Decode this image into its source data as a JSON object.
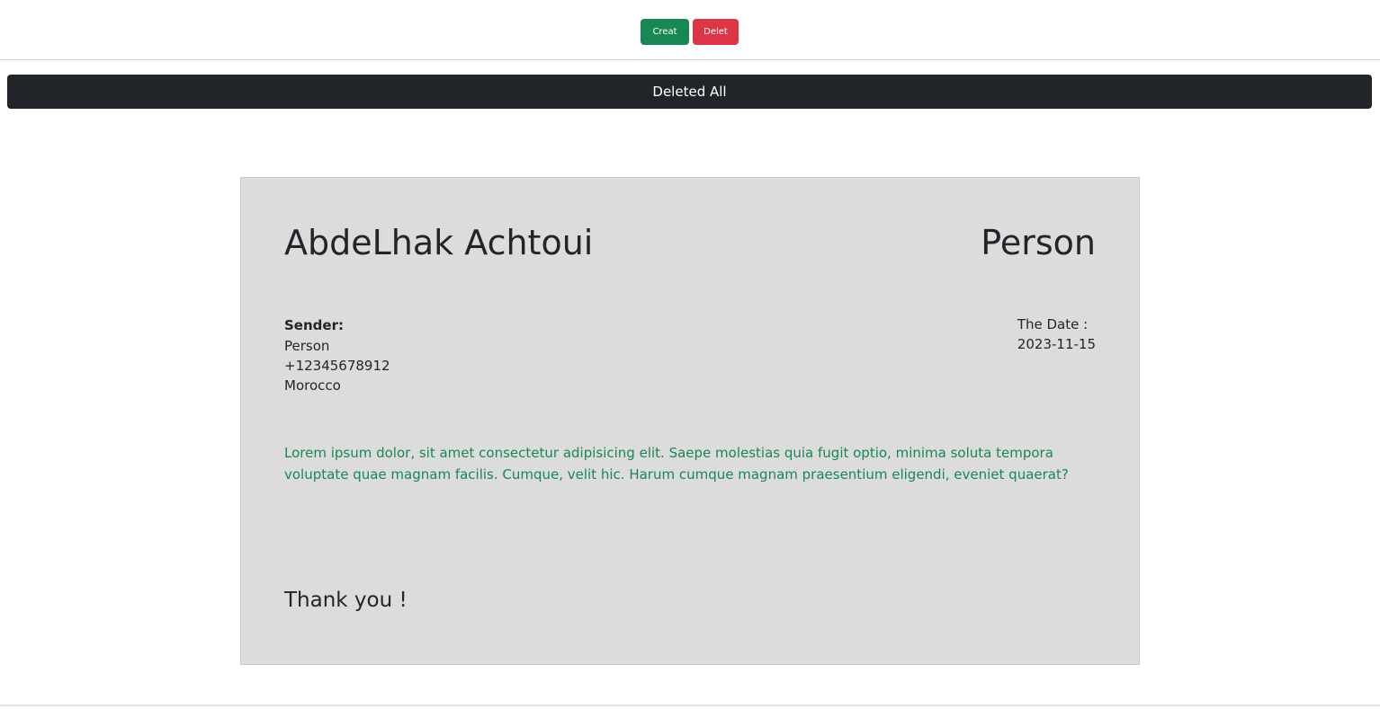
{
  "toolbar": {
    "create_label": "Creat",
    "delete_label": "Delet",
    "create_color": "#198754",
    "delete_color": "#dc3545"
  },
  "actions": {
    "delete_all_label": "Deleted All"
  },
  "card": {
    "name": "AbdeLhak Achtoui",
    "role": "Person",
    "sender": {
      "label": "Sender:",
      "type": "Person",
      "phone": "+12345678912",
      "country": "Morocco"
    },
    "date": {
      "label": "The Date :",
      "value": "2023-11-15"
    },
    "message": "Lorem ipsum dolor, sit amet consectetur adipisicing elit. Saepe molestias quia fugit optio, minima soluta tempora voluptate quae magnam facilis. Cumque, velit hic. Harum cumque magnam praesentium eligendi, eveniet quaerat?",
    "closing": "Thank you !",
    "background_color": "#dcdcdc",
    "message_color": "#198754"
  }
}
